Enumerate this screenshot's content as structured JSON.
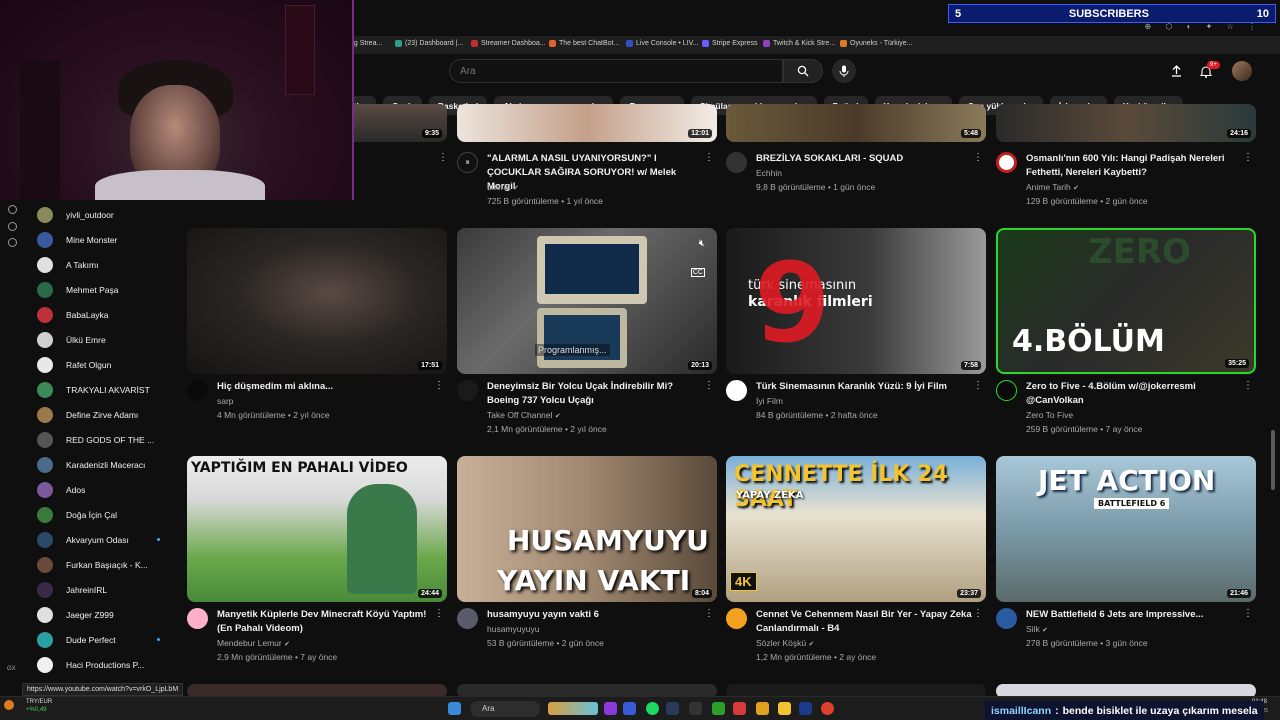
{
  "subscribers": {
    "left_num": "5",
    "label": "SUBSCRIBERS",
    "right_num": "10"
  },
  "bookmarks": [
    {
      "label": "ng Strea..."
    },
    {
      "label": "(23) Dashboard |..."
    },
    {
      "label": "Streamer Dashboa..."
    },
    {
      "label": "The best ChatBot..."
    },
    {
      "label": "Live Console • LIV..."
    },
    {
      "label": "Stripe Express"
    },
    {
      "label": "Twitch & Kick Stre..."
    },
    {
      "label": "Oyuneks - Türkiye..."
    }
  ],
  "search": {
    "placeholder": "Ara"
  },
  "notifications": {
    "badge": "9+"
  },
  "chips": [
    "stler",
    "Canlı",
    "Basketbol",
    "Aksiyon-macera oyunları",
    "Rap yapma",
    "Simülasyon video oyunları",
    "Futbol",
    "Yemek pişirme",
    "Son yüklenenler",
    "İzlenenler",
    "Yeni öneriler"
  ],
  "sidebar": {
    "items": [
      {
        "label": "yivli_outdoor",
        "color": "#8a8a5a",
        "dot": false
      },
      {
        "label": "Mine Monster",
        "color": "#3a5aa0",
        "dot": false
      },
      {
        "label": "A Takımı",
        "color": "#e0e0e0",
        "dot": false
      },
      {
        "label": "Mehmet Paşa",
        "color": "#2a6a4a",
        "dot": false
      },
      {
        "label": "BabaLayka",
        "color": "#c0303a",
        "dot": false
      },
      {
        "label": "Ülkü Emre",
        "color": "#d0d0d0",
        "dot": false
      },
      {
        "label": "Rafet Olgun",
        "color": "#e8e8e8",
        "dot": false
      },
      {
        "label": "TRAKYALI AKVARİST",
        "color": "#3a8a5a",
        "dot": false
      },
      {
        "label": "Define Zirve Adamı",
        "color": "#9a7a4a",
        "dot": false
      },
      {
        "label": "RED GODS OF THE ...",
        "color": "#555555",
        "dot": false
      },
      {
        "label": "Karadenizli Maceracı",
        "color": "#4a6a8a",
        "dot": false
      },
      {
        "label": "Ados",
        "color": "#7a5a9a",
        "dot": false
      },
      {
        "label": "Doğa İçin Çal",
        "color": "#3a7a3a",
        "dot": false
      },
      {
        "label": "Akvaryum Odası",
        "color": "#2a4a6a",
        "dot": true
      },
      {
        "label": "Furkan Başıaçık - K...",
        "color": "#6a4a3a",
        "dot": false
      },
      {
        "label": "JahreinIRL",
        "color": "#3a2a4a",
        "dot": false
      },
      {
        "label": "Jaeger Z999",
        "color": "#e0e0e0",
        "dot": false
      },
      {
        "label": "Dude Perfect",
        "color": "#2aa0a0",
        "dot": true
      },
      {
        "label": "Haci Productions P...",
        "color": "#f0f0f0",
        "dot": false
      }
    ]
  },
  "row0": [
    {
      "duration": "9:35",
      "title": "",
      "channel": "",
      "stats": ""
    },
    {
      "duration": "12:01",
      "title": "\"ALARMLA NASIL UYANIYORSUN?\" I ÇOCUKLAR SAĞIRA SORUYOR! w/ Melek Morgil",
      "channel": "Literat",
      "stats": "725 B görüntüleme • 1 yıl önce",
      "verified": true
    },
    {
      "duration": "5:48",
      "title": "BREZİLYA SOKAKLARI - SQUAD",
      "channel": "Echhin",
      "stats": "9,8 B görüntüleme • 1 gün önce",
      "verified": false
    },
    {
      "duration": "24:16",
      "title": "Osmanlı'nın 600 Yılı: Hangi Padişah Nereleri Fethetti, Nereleri Kaybetti?",
      "channel": "Anime Tarih",
      "stats": "129 B görüntüleme • 2 gün önce",
      "verified": true
    }
  ],
  "row1": [
    {
      "duration": "17:51",
      "title": "Hiç düşmedim mi aklına...",
      "channel": "sarp",
      "stats": "4 Mn görüntüleme • 2 yıl önce",
      "verified": false
    },
    {
      "duration": "20:13",
      "title": "Deneyimsiz Bir Yolcu Uçak İndirebilir Mi? Boeing 737 Yolcu Uçağı",
      "channel": "Take Off Channel",
      "stats": "2,1 Mn görüntüleme • 2 yıl önce",
      "verified": true,
      "overlay": "Programlanmış..."
    },
    {
      "duration": "7:58",
      "title": "Türk Sinemasının Karanlık Yüzü: 9 İyi Film",
      "channel": "İyi Film",
      "stats": "84 B görüntüleme • 2 hafta önce",
      "verified": false,
      "thumb_small": "türk sinemasının",
      "thumb_big": "karanlık filmleri",
      "thumb_num": "9"
    },
    {
      "duration": "35:25",
      "title": "Zero to Five - 4.Bölüm w/@jokerresmi @CanVolkan",
      "channel": "Zero To Five",
      "stats": "259 B görüntüleme • 7 ay önce",
      "verified": false,
      "thumb_text": "4.BÖLÜM",
      "thumb_top": "ZERO"
    }
  ],
  "row2": [
    {
      "duration": "24:44",
      "title": "Manyetik Küplerle Dev Minecraft Köyü Yaptım! (En Pahalı Videom)",
      "channel": "Mendebur Lemur",
      "stats": "2,9 Mn görüntüleme • 7 ay önce",
      "verified": true,
      "thumb_text": "YAPTIĞIM EN PAHALI VİDEO"
    },
    {
      "duration": "8:04",
      "title": "husamyuyu yayın vakti 6",
      "channel": "husamyuyuyu",
      "stats": "53 B görüntüleme • 2 gün önce",
      "verified": false,
      "thumb_line1": "HUSAMYUYU",
      "thumb_line2": "YAYIN VAKTI 6"
    },
    {
      "duration": "23:37",
      "title": "Cennet Ve Cehennem Nasıl Bir Yer - Yapay Zeka Canlandırmalı - B4",
      "channel": "Sözler Köşkü",
      "stats": "1,2 Mn görüntüleme • 2 ay önce",
      "verified": true,
      "thumb_line1": "CENNETTE İLK 24 SAAT",
      "thumb_line2": "YAPAY ZEKA",
      "thumb_badge": "4K"
    },
    {
      "duration": "21:46",
      "title": "NEW Battlefield 6 Jets are Impressive...",
      "channel": "Silk",
      "stats": "278 B görüntüleme • 3 gün önce",
      "verified": true,
      "thumb_line1": "JET ACTION",
      "thumb_line2": "BATTLEFIELD 6"
    }
  ],
  "status_url": "https://www.youtube.com/watch?v=vrkO_LjpLbM",
  "taskbar": {
    "ticker": "TRY/EUR",
    "ticker_change": "+%0,49",
    "search": "Ara",
    "time": "01:48",
    "date": "10.2025"
  },
  "chat": {
    "user": "ismaillIcann",
    "sep": ":",
    "message": "bende bisiklet ile uzaya çıkarım mesela"
  }
}
